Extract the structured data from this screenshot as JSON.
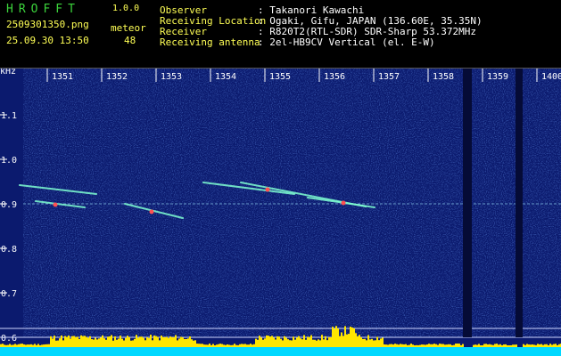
{
  "app": {
    "name": "HROFFT",
    "version": "1.0.0"
  },
  "capture": {
    "filename": "2509301350.png",
    "datetime": "25.09.30 13:50",
    "meteor_label": "meteor",
    "meteor_count": "48"
  },
  "station": [
    {
      "label": "Observer",
      "value": ": Takanori Kawachi"
    },
    {
      "label": "Receiving Location",
      "value": ": Ogaki, Gifu, JAPAN (136.60E, 35.35N)"
    },
    {
      "label": "Receiver",
      "value": ": R820T2(RTL-SDR) SDR-Sharp 53.372MHz"
    },
    {
      "label": "Receiving antenna",
      "value": ": 2el-HB9CV Vertical (el. E-W)"
    }
  ],
  "spectrogram": {
    "y_unit": "kHz",
    "y_ticks": [
      "1.1",
      "1.0",
      "0.9",
      "0.8",
      "0.7",
      "0.6"
    ],
    "y_values": [
      1.1,
      1.0,
      0.9,
      0.8,
      0.7,
      0.6
    ],
    "x_ticks": [
      "1351",
      "1352",
      "1353",
      "1354",
      "1355",
      "1356",
      "1357",
      "1358",
      "1359",
      "1400"
    ],
    "colors": {
      "background": "#0b1a6e",
      "carrier": "#9fe8ff",
      "level": "#ffe600",
      "level_base": "#00d8ff"
    }
  }
}
